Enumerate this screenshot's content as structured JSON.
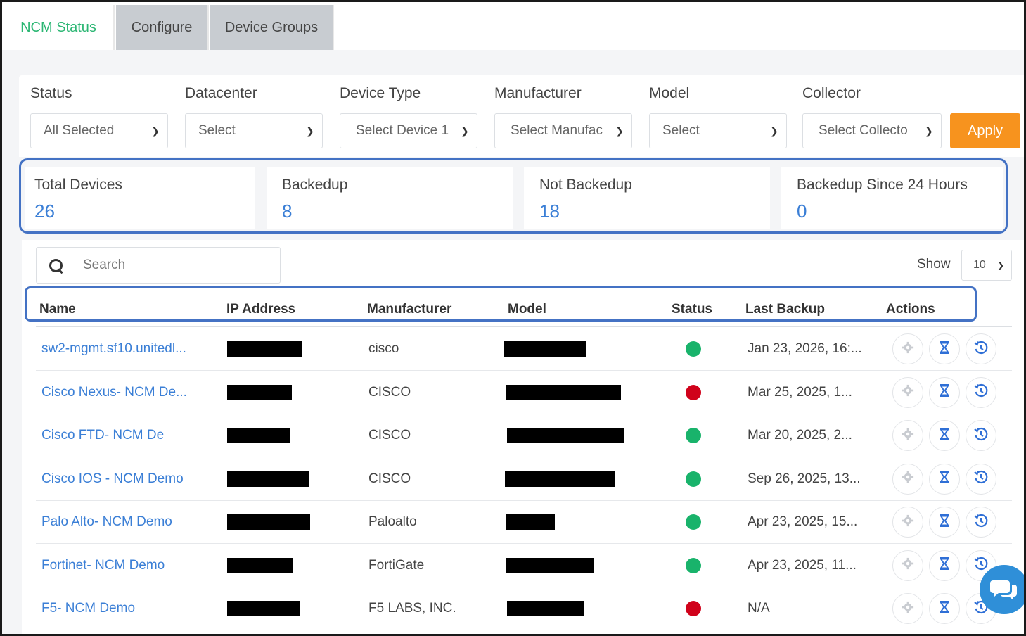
{
  "tabs": [
    {
      "label": "NCM Status",
      "active": true
    },
    {
      "label": "Configure",
      "active": false
    },
    {
      "label": "Device Groups",
      "active": false
    }
  ],
  "filters": [
    {
      "label": "Status",
      "value": "All Selected"
    },
    {
      "label": "Datacenter",
      "value": "Select"
    },
    {
      "label": "Device Type",
      "value": "Select Device 1"
    },
    {
      "label": "Manufacturer",
      "value": "Select Manufac"
    },
    {
      "label": "Model",
      "value": "Select"
    },
    {
      "label": "Collector",
      "value": "Select Collecto"
    }
  ],
  "apply_label": "Apply",
  "summary": [
    {
      "label": "Total Devices",
      "value": "26"
    },
    {
      "label": "Backedup",
      "value": "8"
    },
    {
      "label": "Not Backedup",
      "value": "18"
    },
    {
      "label": "Backedup Since 24 Hours",
      "value": "0"
    }
  ],
  "search": {
    "placeholder": "Search"
  },
  "show": {
    "label": "Show",
    "value": "10"
  },
  "columns": [
    "Name",
    "IP Address",
    "Manufacturer",
    "Model",
    "Status",
    "Last Backup",
    "Actions"
  ],
  "rows": [
    {
      "name": "sw2-mgmt.sf10.unitedl...",
      "manufacturer": "cisco",
      "status": "ok",
      "last_backup": "Jan 23, 2026, 16:..."
    },
    {
      "name": "Cisco Nexus- NCM De...",
      "manufacturer": "CISCO",
      "status": "fail",
      "last_backup": "Mar 25, 2025, 1..."
    },
    {
      "name": "Cisco FTD- NCM De",
      "manufacturer": "CISCO",
      "status": "ok",
      "last_backup": "Mar 20, 2025, 2..."
    },
    {
      "name": "Cisco IOS - NCM Demo",
      "manufacturer": "CISCO",
      "status": "ok",
      "last_backup": "Sep 26, 2025, 13..."
    },
    {
      "name": "Palo Alto- NCM Demo",
      "manufacturer": "Paloalto",
      "status": "ok",
      "last_backup": "Apr 23, 2025, 15..."
    },
    {
      "name": "Fortinet- NCM Demo",
      "manufacturer": "FortiGate",
      "status": "ok",
      "last_backup": "Apr 23, 2025, 11..."
    },
    {
      "name": "F5- NCM Demo",
      "manufacturer": "F5 LABS, INC.",
      "status": "fail",
      "last_backup": "N/A"
    }
  ],
  "colors": {
    "accent_green": "#2bb673",
    "link_blue": "#3b7fd6",
    "apply_orange": "#f7931e",
    "status_ok": "#19b36b",
    "status_fail": "#d0021b",
    "highlight": "#4472c4"
  },
  "icons": {
    "settings": "gear-icon",
    "schedule": "hourglass-icon",
    "restore": "history-icon",
    "chat": "chat-icon"
  }
}
